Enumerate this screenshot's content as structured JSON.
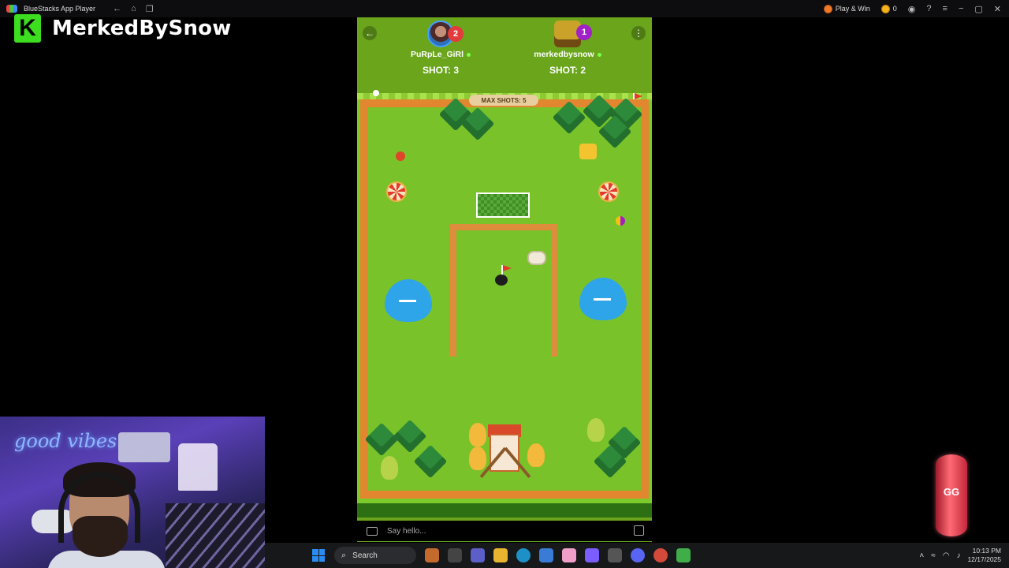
{
  "window": {
    "title": "BlueStacks App Player",
    "play_and_win": "Play & Win",
    "coins": "0"
  },
  "brand": {
    "logo_letter": "K",
    "channel_name": "MerkedBySnow"
  },
  "webcam": {
    "neon_sign": "good vibes"
  },
  "game": {
    "player1": {
      "name": "PuRpLe_GiRl",
      "rank": "2",
      "shots_label": "SHOT: 3"
    },
    "player2": {
      "name": "merkedbysnow",
      "rank": "1",
      "shots_label": "SHOT: 2"
    },
    "max_shots_label": "MAX SHOTS: 5",
    "chat_placeholder": "Say hello..."
  },
  "overlay": {
    "coin_text": "GG"
  },
  "taskbar": {
    "search_label": "Search",
    "time": "10:13 PM",
    "date": "12/17/2025"
  },
  "colors": {
    "course_grass": "#7ac22a",
    "fence": "#e2862f",
    "brand_green": "#3cde1f"
  }
}
